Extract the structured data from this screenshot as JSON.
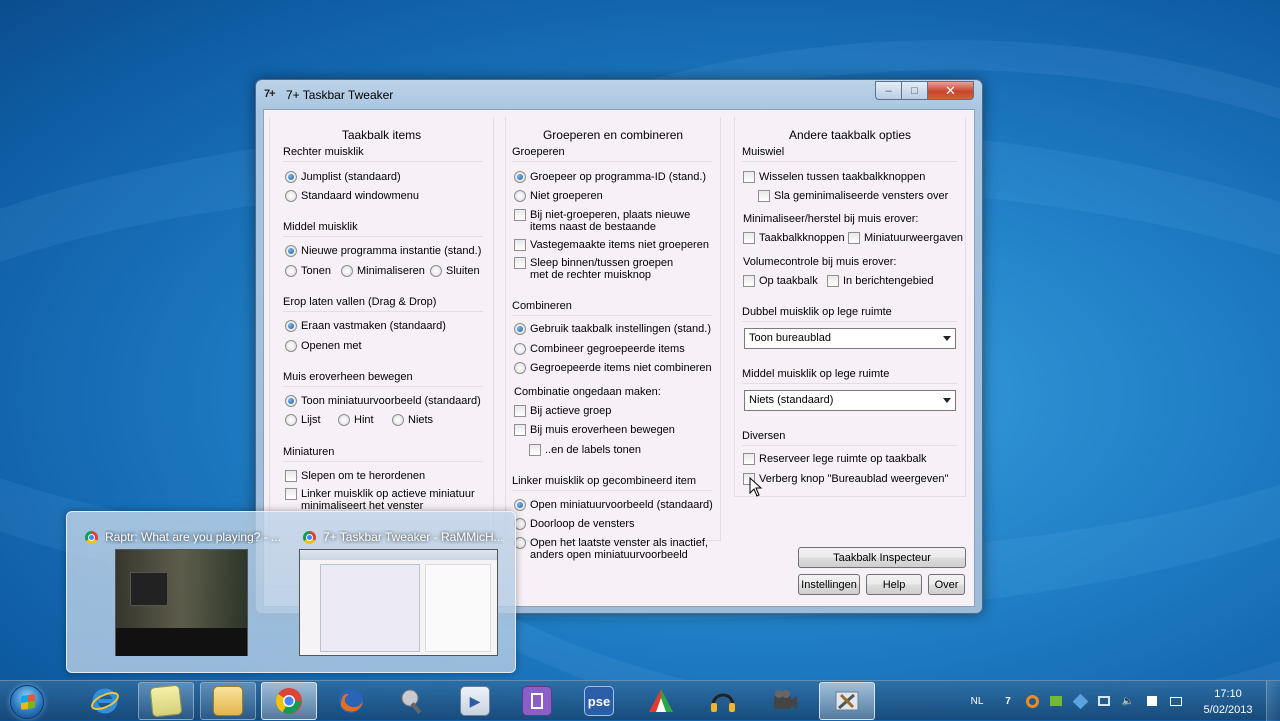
{
  "window": {
    "title": "7+ Taskbar Tweaker",
    "app_icon_text": "7+",
    "controls": {
      "minimize": "–",
      "maximize": "□",
      "close": "✕"
    }
  },
  "col1": {
    "title": "Taakbalk items",
    "right_click": {
      "label": "Rechter muisklik",
      "options": [
        "Jumplist (standaard)",
        "Standaard windowmenu"
      ]
    },
    "middle_click": {
      "label": "Middel muisklik",
      "options": [
        "Nieuwe programma instantie (stand.)",
        "Tonen",
        "Minimaliseren",
        "Sluiten"
      ]
    },
    "drag_drop": {
      "label": "Erop laten vallen (Drag & Drop)",
      "options": [
        "Eraan vastmaken (standaard)",
        "Openen met"
      ]
    },
    "hover": {
      "label": "Muis eroverheen bewegen",
      "options": [
        "Toon miniatuurvoorbeeld (standaard)",
        "Lijst",
        "Hint",
        "Niets"
      ]
    },
    "thumbnails": {
      "label": "Miniaturen",
      "options": [
        "Slepen om te herordenen",
        "Linker muisklik op actieve miniatuur minimaliseert het venster"
      ]
    }
  },
  "col2": {
    "title": "Groeperen en combineren",
    "grouping": {
      "label": "Groeperen",
      "radios": [
        "Groepeer op programma-ID (stand.)",
        "Niet groeperen"
      ],
      "checks": [
        "Bij niet-groeperen, plaats nieuwe items naast de bestaande",
        "Vastegemaakte items niet groeperen",
        "Sleep binnen/tussen groepen met de rechter muisknop"
      ]
    },
    "combining": {
      "label": "Combineren",
      "radios": [
        "Gebruik taakbalk instellingen (stand.)",
        "Combineer gegroepeerde items",
        "Gegroepeerde items niet combineren"
      ],
      "undo_label": "Combinatie ongedaan maken:",
      "checks": [
        "Bij actieve groep",
        "Bij muis eroverheen bewegen",
        "..en de labels tonen"
      ]
    },
    "left_click": {
      "label": "Linker muisklik op gecombineerd item",
      "radios": [
        "Open miniatuurvoorbeeld (standaard)",
        "Doorloop de vensters",
        "Open het laatste venster als inactief, anders open miniatuurvoorbeeld"
      ]
    }
  },
  "col3": {
    "title": "Andere taakbalk opties",
    "wheel": {
      "label": "Muiswiel",
      "checks": [
        "Wisselen tussen taakbalkknoppen",
        "Sla geminimaliseerde vensters over"
      ],
      "minimize_label": "Minimaliseer/herstel bij muis erover:",
      "minimize_checks": [
        "Taakbalkknoppen",
        "Miniatuurweergaven"
      ],
      "volume_label": "Volumecontrole bij muis erover:",
      "volume_checks": [
        "Op taakbalk",
        "In berichtengebied"
      ]
    },
    "double_click": {
      "label": "Dubbel muisklik op lege ruimte",
      "value": "Toon bureaublad"
    },
    "middle_empty": {
      "label": "Middel muisklik op lege ruimte",
      "value": "Niets (standaard)"
    },
    "misc": {
      "label": "Diversen",
      "checks": [
        "Reserveer lege ruimte op taakbalk",
        "Verberg knop \"Bureaublad weergeven\""
      ]
    }
  },
  "buttons": {
    "inspector": "Taakbalk Inspecteur",
    "settings": "Instellingen",
    "help": "Help",
    "about": "Over"
  },
  "thumbnail_popup": {
    "items": [
      {
        "title": "Raptr: What are you playing? - ..."
      },
      {
        "title": "7+ Taskbar Tweaker - RaMMicH..."
      }
    ]
  },
  "taskbar": {
    "language": "NL",
    "time": "17:10",
    "date": "5/02/2013",
    "apps": [
      "internet-explorer",
      "sticky-notes",
      "windows-explorer",
      "chrome",
      "firefox",
      "paint-tool",
      "media-app",
      "movie-app",
      "pse",
      "color-app",
      "audio-headphones",
      "audacity",
      "video-camera",
      "taskbar-tweaker-tools"
    ],
    "pse_label": "pse"
  }
}
